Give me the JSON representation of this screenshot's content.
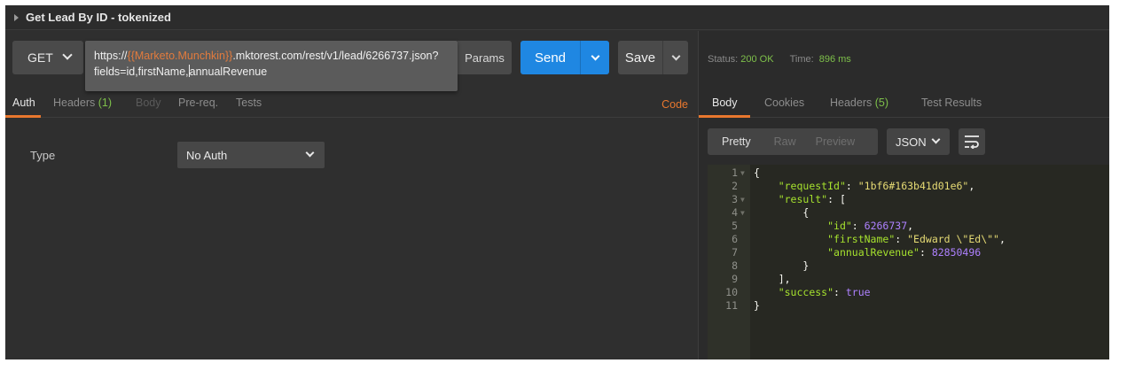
{
  "window": {
    "title": "Get Lead By ID - tokenized"
  },
  "request": {
    "method": "GET",
    "url_prefix": "https://",
    "url_var": "{{Marketo.Munchkin}}",
    "url_line1_rest": ".mktorest.com/rest/v1/lead/6266737.json?",
    "url_line2_before_cursor": "fields=id,firstName,",
    "url_line2_after_cursor": "annualRevenue",
    "params_label": "Params",
    "send_label": "Send",
    "save_label": "Save"
  },
  "left_tabs": {
    "auth": "Auth",
    "headers": "Headers",
    "headers_count": "(1)",
    "body": "Body",
    "prereq": "Pre-req.",
    "tests": "Tests",
    "code": "Code"
  },
  "auth": {
    "type_label": "Type",
    "selected": "No Auth"
  },
  "response": {
    "status_label": "Status:",
    "status_value": "200 OK",
    "time_label": "Time:",
    "time_value": "896 ms",
    "tabs": {
      "body": "Body",
      "cookies": "Cookies",
      "headers": "Headers",
      "headers_count": "(5)",
      "test_results": "Test Results"
    },
    "view_modes": {
      "pretty": "Pretty",
      "raw": "Raw",
      "preview": "Preview"
    },
    "format": "JSON",
    "lines": [
      {
        "n": "1",
        "fold": "▼",
        "tokens": [
          [
            "p",
            "{"
          ]
        ]
      },
      {
        "n": "2",
        "fold": "",
        "tokens": [
          [
            "p",
            "    "
          ],
          [
            "k",
            "\"requestId\""
          ],
          [
            "p",
            ": "
          ],
          [
            "s",
            "\"1bf6#163b41d01e6\""
          ],
          [
            "p",
            ","
          ]
        ]
      },
      {
        "n": "3",
        "fold": "▼",
        "tokens": [
          [
            "p",
            "    "
          ],
          [
            "k",
            "\"result\""
          ],
          [
            "p",
            ": ["
          ]
        ]
      },
      {
        "n": "4",
        "fold": "▼",
        "tokens": [
          [
            "p",
            "        {"
          ]
        ]
      },
      {
        "n": "5",
        "fold": "",
        "tokens": [
          [
            "p",
            "            "
          ],
          [
            "k",
            "\"id\""
          ],
          [
            "p",
            ": "
          ],
          [
            "n",
            "6266737"
          ],
          [
            "p",
            ","
          ]
        ]
      },
      {
        "n": "6",
        "fold": "",
        "tokens": [
          [
            "p",
            "            "
          ],
          [
            "k",
            "\"firstName\""
          ],
          [
            "p",
            ": "
          ],
          [
            "s",
            "\"Edward \\\"Ed\\\"\""
          ],
          [
            "p",
            ","
          ]
        ]
      },
      {
        "n": "7",
        "fold": "",
        "tokens": [
          [
            "p",
            "            "
          ],
          [
            "k",
            "\"annualRevenue\""
          ],
          [
            "p",
            ": "
          ],
          [
            "n",
            "82850496"
          ]
        ]
      },
      {
        "n": "8",
        "fold": "",
        "tokens": [
          [
            "p",
            "        }"
          ]
        ]
      },
      {
        "n": "9",
        "fold": "",
        "tokens": [
          [
            "p",
            "    ],"
          ]
        ]
      },
      {
        "n": "10",
        "fold": "",
        "tokens": [
          [
            "p",
            "    "
          ],
          [
            "k",
            "\"success\""
          ],
          [
            "p",
            ": "
          ],
          [
            "b",
            "true"
          ]
        ]
      },
      {
        "n": "11",
        "fold": "",
        "tokens": [
          [
            "p",
            "}"
          ]
        ]
      }
    ]
  },
  "colors": {
    "accent": "#e8772e",
    "send": "#1f87e2",
    "ok": "#7ec04a",
    "url_var": "#e27b3d"
  },
  "icons": {
    "wrap": "wrap-lines-icon",
    "dropdown": "chevron-down-icon"
  }
}
